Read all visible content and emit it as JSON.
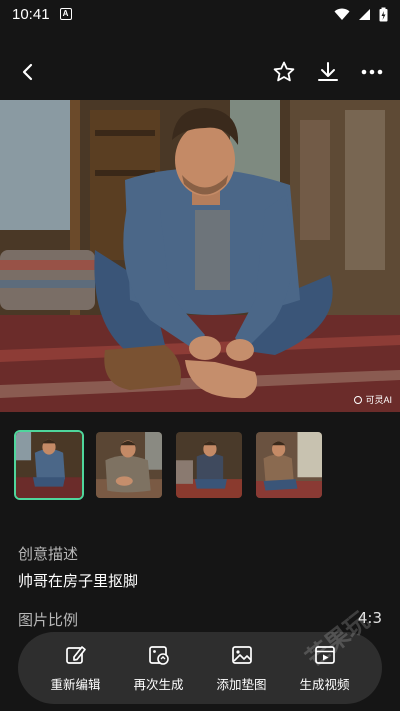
{
  "status_bar": {
    "time": "10:41",
    "notif_glyph": "A"
  },
  "toolbar": {
    "back_icon": "chevron-left-icon",
    "star_icon": "star-icon",
    "download_icon": "download-icon",
    "more_icon": "more-icon"
  },
  "image": {
    "badge_text": "可灵AI"
  },
  "thumbnails": {
    "selected_index": 0,
    "count": 4
  },
  "info": {
    "description_label": "创意描述",
    "description_value": "帅哥在房子里抠脚",
    "ratio_label": "图片比例",
    "ratio_value": "4:3"
  },
  "actions": [
    {
      "label": "重新编辑",
      "icon": "edit-icon"
    },
    {
      "label": "再次生成",
      "icon": "regenerate-icon"
    },
    {
      "label": "添加垫图",
      "icon": "add-image-icon"
    },
    {
      "label": "生成视频",
      "icon": "video-icon"
    }
  ],
  "watermark": "芒果玩"
}
